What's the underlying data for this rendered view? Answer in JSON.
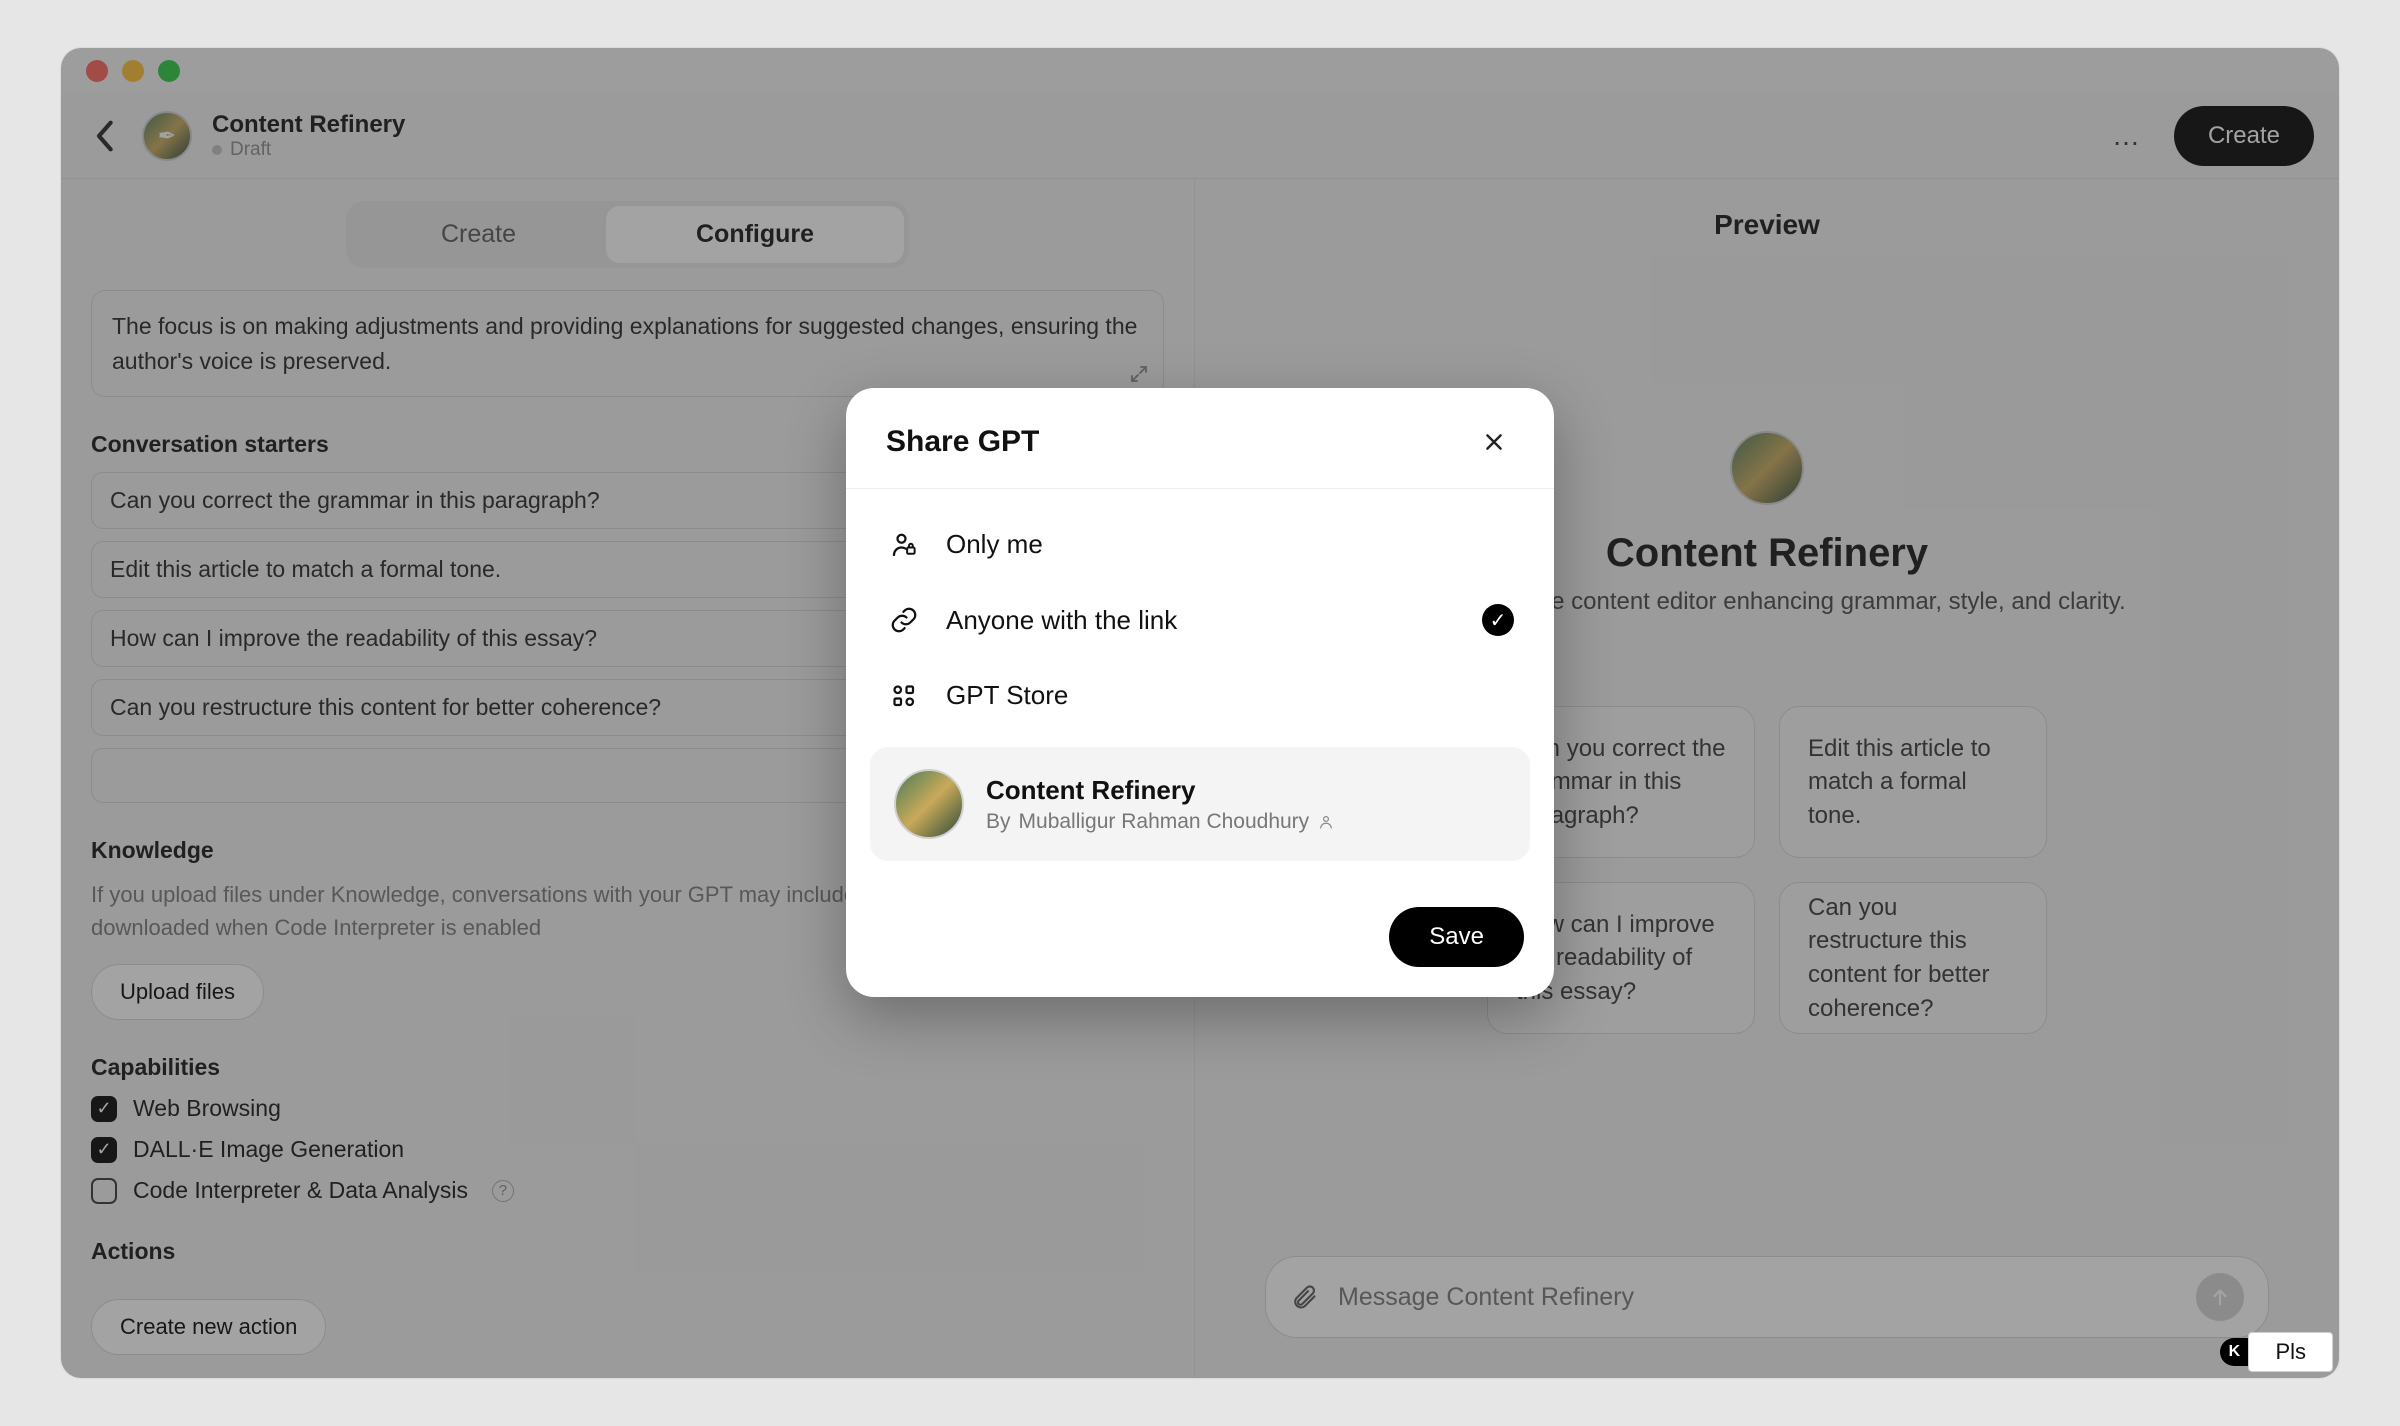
{
  "header": {
    "title": "Content Refinery",
    "draft_label": "Draft",
    "more_label": "…",
    "create_label": "Create"
  },
  "tabs": {
    "create": "Create",
    "configure": "Configure"
  },
  "instructions_excerpt": "The focus is on making adjustments and providing explanations for suggested changes, ensuring the author's voice is preserved.",
  "labels": {
    "conversation_starters": "Conversation starters",
    "knowledge": "Knowledge",
    "knowledge_help": "If you upload files under Knowledge, conversations with your GPT may include file contents. Files can be downloaded when Code Interpreter is enabled",
    "upload_files": "Upload files",
    "capabilities": "Capabilities",
    "actions": "Actions",
    "create_action": "Create new action"
  },
  "starters": [
    "Can you correct the grammar in this paragraph?",
    "Edit this article to match a formal tone.",
    "How can I improve the readability of this essay?",
    "Can you restructure this content for better coherence?"
  ],
  "capabilities": [
    {
      "label": "Web Browsing",
      "checked": true,
      "help": false
    },
    {
      "label": "DALL·E Image Generation",
      "checked": true,
      "help": false
    },
    {
      "label": "Code Interpreter & Data Analysis",
      "checked": false,
      "help": true
    }
  ],
  "preview": {
    "heading": "Preview",
    "name": "Content Refinery",
    "desc": "A collaborative content editor enhancing grammar, style, and clarity.",
    "cards": [
      "Can you correct the grammar in this paragraph?",
      "Edit this article to match a formal tone.",
      "How can I improve the readability of this essay?",
      "Can you restructure this content for better coherence?"
    ],
    "chat_placeholder": "Message Content Refinery"
  },
  "modal": {
    "title": "Share GPT",
    "options": {
      "only_me": "Only me",
      "anyone": "Anyone with the link",
      "store": "GPT Store"
    },
    "selected": "anyone",
    "gpt_name": "Content Refinery",
    "author_prefix": "By ",
    "author_name": "Muballigur Rahman Choudhury",
    "save_label": "Save"
  },
  "status_chip": {
    "k": "K",
    "text": "Pls"
  }
}
